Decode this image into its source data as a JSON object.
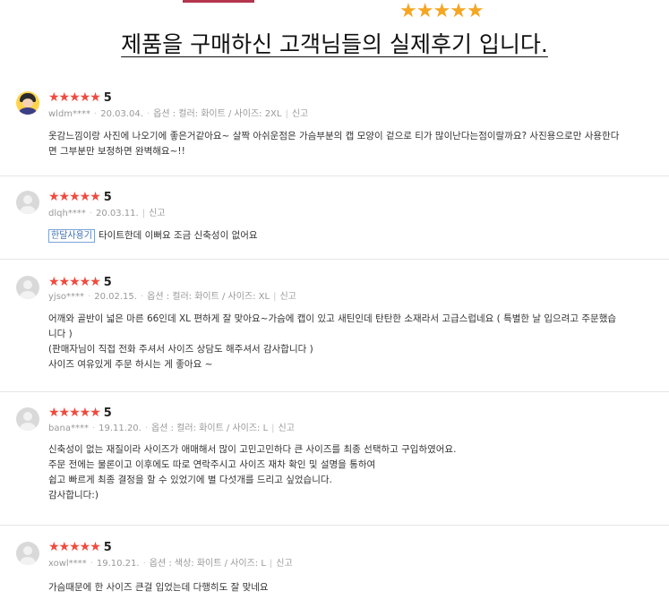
{
  "header": {
    "stars": "★★★★★",
    "title": "제품을 구매하신 고객님들의 실제후기 입니다."
  },
  "colors": {
    "star_header": "#f5a623",
    "star_rating": "#f04a3e",
    "accent": "#b3364e"
  },
  "reviews": [
    {
      "stars": "★★★★★",
      "score": "5",
      "author": "wldm****",
      "date": "20.03.04.",
      "options": "옵션 : 컬러: 화이트 / 사이즈: 2XL",
      "report": "신고",
      "lines": [
        "옷감느낌이랑 사진에 나오기에 좋은거같아요~ 살짝 아쉬운점은 가슴부분의 캡 모양이 겉으로 티가 많이난다는점이랄까요? 사진용으로만 사용한다",
        "면 그부분만 보정하면 완벽해요~!!"
      ]
    },
    {
      "stars": "★★★★★",
      "score": "5",
      "author": "dlqh****",
      "date": "20.03.11.",
      "report": "신고",
      "tag": "한달사용기",
      "lines": [
        "타이트한데 이뻐요 조금 신축성이 없어요"
      ]
    },
    {
      "stars": "★★★★★",
      "score": "5",
      "author": "yjso****",
      "date": "20.02.15.",
      "options": "옵션 : 컬러: 화이트 / 사이즈: XL",
      "report": "신고",
      "lines": [
        "어깨와 골반이 넓은 마른 66인데 XL 편하게 잘 맞아요~가슴에 캡이 있고 새틴인데 탄탄한 소재라서 고급스럽네요 ( 특별한 날 입으려고 주문했습",
        "니다 )",
        "(판매자님이 직접 전화 주셔서 사이즈 상담도 해주셔서 감사합니다 )",
        "사이즈 여유있게 주문 하시는 게 좋아요 ~"
      ]
    },
    {
      "stars": "★★★★★",
      "score": "5",
      "author": "bana****",
      "date": "19.11.20.",
      "options": "옵션 : 컬러: 화이트 / 사이즈: L",
      "report": "신고",
      "lines": [
        "신축성이 없는 재질이라 사이즈가 애매해서 많이 고민고민하다 큰 사이즈를 최종 선택하고 구입하였어요.",
        "주문 전에는 물론이고 이후에도 따로 연락주시고 사이즈 재차 확인 및 설명을 통하여",
        "쉽고 빠르게 최종 결정을 할 수 있었기에 별 다섯개를 드리고 싶었습니다.",
        "감사합니다:)"
      ]
    },
    {
      "stars": "★★★★★",
      "score": "5",
      "author": "xowl****",
      "date": "19.10.21.",
      "options": "옵션 : 색상: 화이트 / 사이즈: L",
      "report": "신고",
      "lines": [
        "가슴때문에 한 사이즈 큰걸 입었는데 다행히도 잘 맞네요"
      ]
    }
  ]
}
